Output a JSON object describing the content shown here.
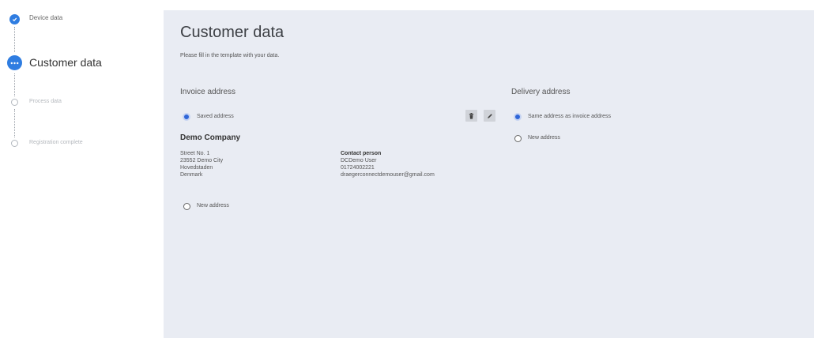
{
  "stepper": {
    "steps": [
      {
        "label": "Device data",
        "status": "complete"
      },
      {
        "label": "Customer data",
        "status": "active"
      },
      {
        "label": "Process data",
        "status": "pending"
      },
      {
        "label": "Registration complete",
        "status": "pending"
      }
    ]
  },
  "main": {
    "title": "Customer data",
    "subtitle": "Please fill in the template with your data."
  },
  "invoice": {
    "title": "Invoice address",
    "saved_label": "Saved address",
    "company": "Demo Company",
    "address_lines": [
      "Street No. 1",
      "23552 Demo City",
      "Hovedstaden",
      "Denmark"
    ],
    "contact_heading": "Contact person",
    "contact_lines": [
      "DCDemo User",
      "01724002221",
      "draegerconnectdemouser@gmail.com"
    ],
    "new_address_label": "New address"
  },
  "delivery": {
    "title": "Delivery address",
    "same_label": "Same address as invoice address",
    "new_address_label": "New address"
  },
  "colors": {
    "accent": "#2f7de1",
    "panel_bg": "#e9ecf3"
  }
}
